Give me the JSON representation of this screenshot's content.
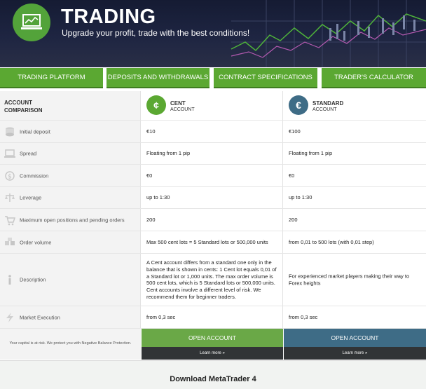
{
  "banner": {
    "title": "TRADING",
    "subtitle": "Upgrade your profit, trade with the best conditions!",
    "icon": "trading-laptop-icon"
  },
  "nav": {
    "items": [
      {
        "label": "TRADING PLATFORM"
      },
      {
        "label": "DEPOSITS AND WITHDRAWALS"
      },
      {
        "label": "CONTRACT SPECIFICATIONS"
      },
      {
        "label": "TRADER'S CALCULATOR"
      }
    ],
    "color": "#5ba832"
  },
  "table": {
    "header": {
      "label_line1": "ACCOUNT",
      "label_line2": "COMPARISON",
      "accounts": [
        {
          "name": "CENT",
          "sub": "ACCOUNT",
          "symbol": "¢",
          "color": "#5ba832"
        },
        {
          "name": "STANDARD",
          "sub": "ACCOUNT",
          "symbol": "€",
          "color": "#3e6c86"
        }
      ]
    },
    "rows": [
      {
        "label": "Initial deposit",
        "icon": "money-stack-icon",
        "cent": "€10",
        "standard": "€100"
      },
      {
        "label": "Spread",
        "icon": "laptop-icon",
        "cent": "Floating from 1 pip",
        "standard": "Floating from 1 pip"
      },
      {
        "label": "Commission",
        "icon": "dollar-icon",
        "cent": "€0",
        "standard": "€0"
      },
      {
        "label": "Leverage",
        "icon": "scale-icon",
        "cent": "up to 1:30",
        "standard": "up to 1:30"
      },
      {
        "label": "Maximum open positions and pending orders",
        "icon": "cart-icon",
        "cent": "200",
        "standard": "200"
      },
      {
        "label": "Order volume",
        "icon": "boxes-icon",
        "cent": "Max 500 cent lots = 5 Standard lots or 500,000 units",
        "standard": "from 0,01 to 500 lots (with 0,01 step)"
      },
      {
        "label": "Description",
        "icon": "info-icon",
        "cent": "A Cent account differs from a standard one only in the balance that is shown in cents: 1 Cent lot equals 0,01 of a Standard lot or 1,000 units. The max order volume is 500 cent lots, which is 5 Standard lots or 500,000 units. Cent accounts involve a different level of risk. We recommend them for beginner traders.",
        "standard": "For experienced market players making their way to Forex heights"
      },
      {
        "label": "Market Execution",
        "icon": "lightning-icon",
        "cent": "from 0,3 sec",
        "standard": "from 0,3 sec"
      }
    ]
  },
  "cta": {
    "risk_note": "Your capital is at risk. We protect you with Negative Balance Protection.",
    "open_cent": "OPEN ACCOUNT",
    "open_standard": "OPEN ACCOUNT",
    "learn_cent": "Learn more »",
    "learn_standard": "Learn more »",
    "cent_color": "#6aa847",
    "standard_color": "#3e6c86"
  },
  "download": {
    "label": "Download MetaTrader 4"
  }
}
